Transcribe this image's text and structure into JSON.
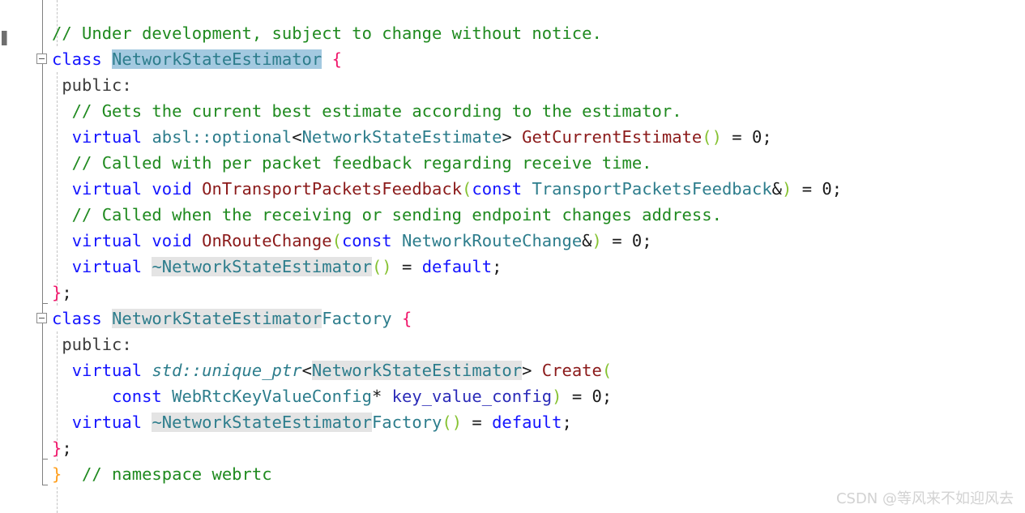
{
  "editor": {
    "background": "#ffffff",
    "language": "C++",
    "edge_glyph": "▌"
  },
  "colors": {
    "comment": "#1f8a1f",
    "keyword": "#1414ff",
    "type": "#2d7d8c",
    "function": "#8b1a1a",
    "paren": "#86c232",
    "plain": "#1a1a1a",
    "brace_pink": "#f0176b",
    "brace_orange": "#ff9e1b",
    "variable": "#2b2bb8",
    "selection_highlight": "#a3c9e0",
    "occurrence_highlight": "#e4e4e4",
    "indent_guide": "#c3c3c3",
    "fold_rail": "#808080",
    "watermark": "#d2d2d2"
  },
  "fold_markers": [
    {
      "label": "collapse-class-NetworkStateEstimator",
      "state": "expanded",
      "glyph": "minus"
    },
    {
      "label": "collapse-class-NetworkStateEstimatorFactory",
      "state": "expanded",
      "glyph": "minus"
    }
  ],
  "lines": [
    {
      "id": "line-comment-under-development",
      "tokens": [
        {
          "text": "// Under development, subject to change without notice.",
          "cls": "t-comment"
        }
      ]
    },
    {
      "id": "line-class-networkstateestimator",
      "tokens": [
        {
          "text": "class ",
          "cls": "t-keyword"
        },
        {
          "text": "NetworkStateEstimator",
          "cls": "t-type",
          "hl": "selected"
        },
        {
          "text": " ",
          "cls": "t-plain"
        },
        {
          "text": "{",
          "cls": "t-brace-pink"
        }
      ]
    },
    {
      "id": "line-public-1",
      "tokens": [
        {
          "text": " public:",
          "cls": "t-label"
        }
      ]
    },
    {
      "id": "line-comment-gets-current-best",
      "tokens": [
        {
          "text": "  // Gets the current best estimate according to the estimator.",
          "cls": "t-comment"
        }
      ]
    },
    {
      "id": "line-getcurrentestimate",
      "tokens": [
        {
          "text": "  ",
          "cls": "t-plain"
        },
        {
          "text": "virtual ",
          "cls": "t-keyword"
        },
        {
          "text": "absl::optional",
          "cls": "t-type"
        },
        {
          "text": "<",
          "cls": "t-plain"
        },
        {
          "text": "NetworkStateEstimate",
          "cls": "t-type"
        },
        {
          "text": "> ",
          "cls": "t-plain"
        },
        {
          "text": "GetCurrentEstimate",
          "cls": "t-func"
        },
        {
          "text": "()",
          "cls": "t-paren"
        },
        {
          "text": " = 0;",
          "cls": "t-plain"
        }
      ]
    },
    {
      "id": "line-comment-called-with-per-packet",
      "tokens": [
        {
          "text": "  // Called with per packet feedback regarding receive time.",
          "cls": "t-comment"
        }
      ]
    },
    {
      "id": "line-ontransportpacketsfeedback",
      "tokens": [
        {
          "text": "  ",
          "cls": "t-plain"
        },
        {
          "text": "virtual void ",
          "cls": "t-keyword"
        },
        {
          "text": "OnTransportPacketsFeedback",
          "cls": "t-func"
        },
        {
          "text": "(",
          "cls": "t-paren"
        },
        {
          "text": "const ",
          "cls": "t-keyword"
        },
        {
          "text": "TransportPacketsFeedback",
          "cls": "t-type"
        },
        {
          "text": "&",
          "cls": "t-plain"
        },
        {
          "text": ")",
          "cls": "t-paren"
        },
        {
          "text": " = 0;",
          "cls": "t-plain"
        }
      ]
    },
    {
      "id": "line-comment-called-when-receiving",
      "tokens": [
        {
          "text": "  // Called when the receiving or sending endpoint changes address.",
          "cls": "t-comment"
        }
      ]
    },
    {
      "id": "line-onroutechange",
      "tokens": [
        {
          "text": "  ",
          "cls": "t-plain"
        },
        {
          "text": "virtual void ",
          "cls": "t-keyword"
        },
        {
          "text": "OnRouteChange",
          "cls": "t-func"
        },
        {
          "text": "(",
          "cls": "t-paren"
        },
        {
          "text": "const ",
          "cls": "t-keyword"
        },
        {
          "text": "NetworkRouteChange",
          "cls": "t-type"
        },
        {
          "text": "&",
          "cls": "t-plain"
        },
        {
          "text": ")",
          "cls": "t-paren"
        },
        {
          "text": " = 0;",
          "cls": "t-plain"
        }
      ]
    },
    {
      "id": "line-destructor-networkstateestimator",
      "tokens": [
        {
          "text": "  ",
          "cls": "t-plain"
        },
        {
          "text": "virtual ",
          "cls": "t-keyword"
        },
        {
          "text": "~NetworkStateEstimator",
          "cls": "t-type",
          "hl": "occurrence"
        },
        {
          "text": "()",
          "cls": "t-paren"
        },
        {
          "text": " = ",
          "cls": "t-plain"
        },
        {
          "text": "default",
          "cls": "t-keyword"
        },
        {
          "text": ";",
          "cls": "t-plain"
        }
      ]
    },
    {
      "id": "line-close-class-1",
      "tokens": [
        {
          "text": "}",
          "cls": "t-brace-pink"
        },
        {
          "text": ";",
          "cls": "t-plain"
        }
      ]
    },
    {
      "id": "line-class-networkstateestimatorfactory",
      "tokens": [
        {
          "text": "class ",
          "cls": "t-keyword"
        },
        {
          "text": "NetworkStateEstimator",
          "cls": "t-type",
          "hl": "occurrence"
        },
        {
          "text": "Factory",
          "cls": "t-type"
        },
        {
          "text": " ",
          "cls": "t-plain"
        },
        {
          "text": "{",
          "cls": "t-brace-pink"
        }
      ]
    },
    {
      "id": "line-public-2",
      "tokens": [
        {
          "text": " public:",
          "cls": "t-label"
        }
      ]
    },
    {
      "id": "line-create-signature",
      "tokens": [
        {
          "text": "  ",
          "cls": "t-plain"
        },
        {
          "text": "virtual ",
          "cls": "t-keyword"
        },
        {
          "text": "std::unique_ptr",
          "cls": "t-type t-italic"
        },
        {
          "text": "<",
          "cls": "t-plain"
        },
        {
          "text": "NetworkStateEstimator",
          "cls": "t-type",
          "hl": "occurrence"
        },
        {
          "text": "> ",
          "cls": "t-plain"
        },
        {
          "text": "Create",
          "cls": "t-func"
        },
        {
          "text": "(",
          "cls": "t-paren"
        }
      ]
    },
    {
      "id": "line-create-param",
      "tokens": [
        {
          "text": "      ",
          "cls": "t-plain"
        },
        {
          "text": "const ",
          "cls": "t-keyword"
        },
        {
          "text": "WebRtcKeyValueConfig",
          "cls": "t-type"
        },
        {
          "text": "* ",
          "cls": "t-plain"
        },
        {
          "text": "key_value_config",
          "cls": "t-var"
        },
        {
          "text": ")",
          "cls": "t-paren"
        },
        {
          "text": " = 0;",
          "cls": "t-plain"
        }
      ]
    },
    {
      "id": "line-destructor-factory",
      "tokens": [
        {
          "text": "  ",
          "cls": "t-plain"
        },
        {
          "text": "virtual ",
          "cls": "t-keyword"
        },
        {
          "text": "~NetworkStateEstimator",
          "cls": "t-type",
          "hl": "occurrence"
        },
        {
          "text": "Factory",
          "cls": "t-type"
        },
        {
          "text": "()",
          "cls": "t-paren"
        },
        {
          "text": " = ",
          "cls": "t-plain"
        },
        {
          "text": "default",
          "cls": "t-keyword"
        },
        {
          "text": ";",
          "cls": "t-plain"
        }
      ]
    },
    {
      "id": "line-close-class-2",
      "tokens": [
        {
          "text": "}",
          "cls": "t-brace-pink"
        },
        {
          "text": ";",
          "cls": "t-plain"
        }
      ]
    },
    {
      "id": "line-close-namespace",
      "tokens": [
        {
          "text": "}",
          "cls": "t-brace-orange"
        },
        {
          "text": "  ",
          "cls": "t-plain"
        },
        {
          "text": "// namespace webrtc",
          "cls": "t-comment"
        }
      ]
    }
  ],
  "watermark": {
    "text": "CSDN @等风来不如迎风去"
  }
}
